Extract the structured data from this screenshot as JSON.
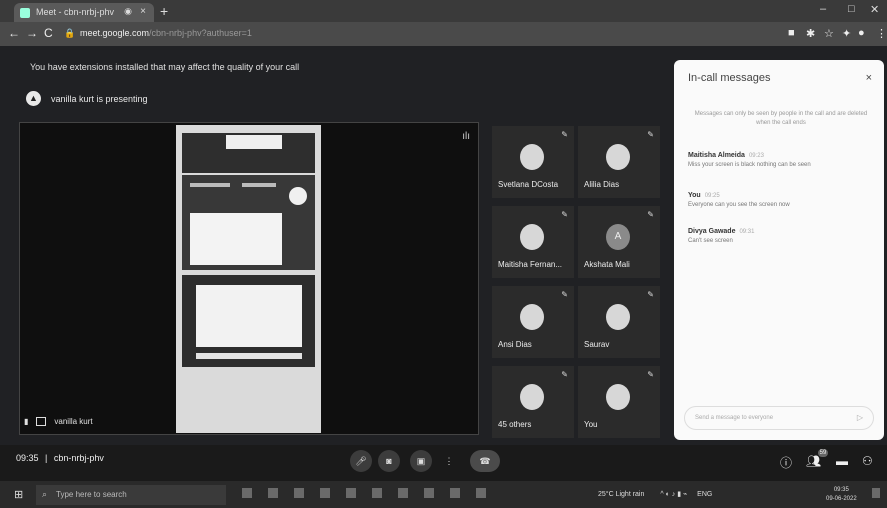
{
  "browser": {
    "tab_title": "Meet - cbn-nrbj-phv",
    "tab_close": "×",
    "tab_audio": "◉",
    "new_tab": "+",
    "win_min": "–",
    "win_max": "□",
    "win_close": "✕",
    "url_domain": "meet.google.com",
    "url_rest": "/cbn-nrbj-phv?authuser=1",
    "back": "←",
    "forward": "→",
    "reload": "C"
  },
  "warning": "You have extensions installed that may affect the quality of your call",
  "presenting": {
    "icon": "present-icon",
    "text": "vanilla kurt is presenting"
  },
  "stage": {
    "presenter_name": "vanilla kurt"
  },
  "tiles": [
    {
      "name": "Svetlana DCosta",
      "avatar": ""
    },
    {
      "name": "Alilia Dias",
      "avatar": ""
    },
    {
      "name": "Maitisha Fernan...",
      "avatar": ""
    },
    {
      "name": "Akshata Mali",
      "avatar": "A"
    },
    {
      "name": "Ansi Dias",
      "avatar": ""
    },
    {
      "name": "Saurav",
      "avatar": ""
    },
    {
      "name": "45 others",
      "avatar": ""
    },
    {
      "name": "You",
      "avatar": ""
    }
  ],
  "panel": {
    "title": "In-call messages",
    "close": "×",
    "note": "Messages can only be seen by people in the call and are deleted when the call ends",
    "messages": [
      {
        "sender": "Maitisha Almeida",
        "time": "09:23",
        "text": "Miss your screen is black nothing can be seen"
      },
      {
        "sender": "You",
        "time": "09:25",
        "text": "Everyone can you see the screen now"
      },
      {
        "sender": "Divya Gawade",
        "time": "09:31",
        "text": "Can't see screen"
      }
    ],
    "input_placeholder": "Send a message to everyone",
    "send": "▷"
  },
  "bottom": {
    "time": "09:35",
    "separator": "|",
    "meeting_code": "cbn-nrbj-phv",
    "people_count": "59"
  },
  "taskbar": {
    "search_placeholder": "Type here to search",
    "weather": "25°C  Light rain",
    "clock_time": "09:35",
    "clock_date": "09-06-2022",
    "lang": "ENG"
  }
}
